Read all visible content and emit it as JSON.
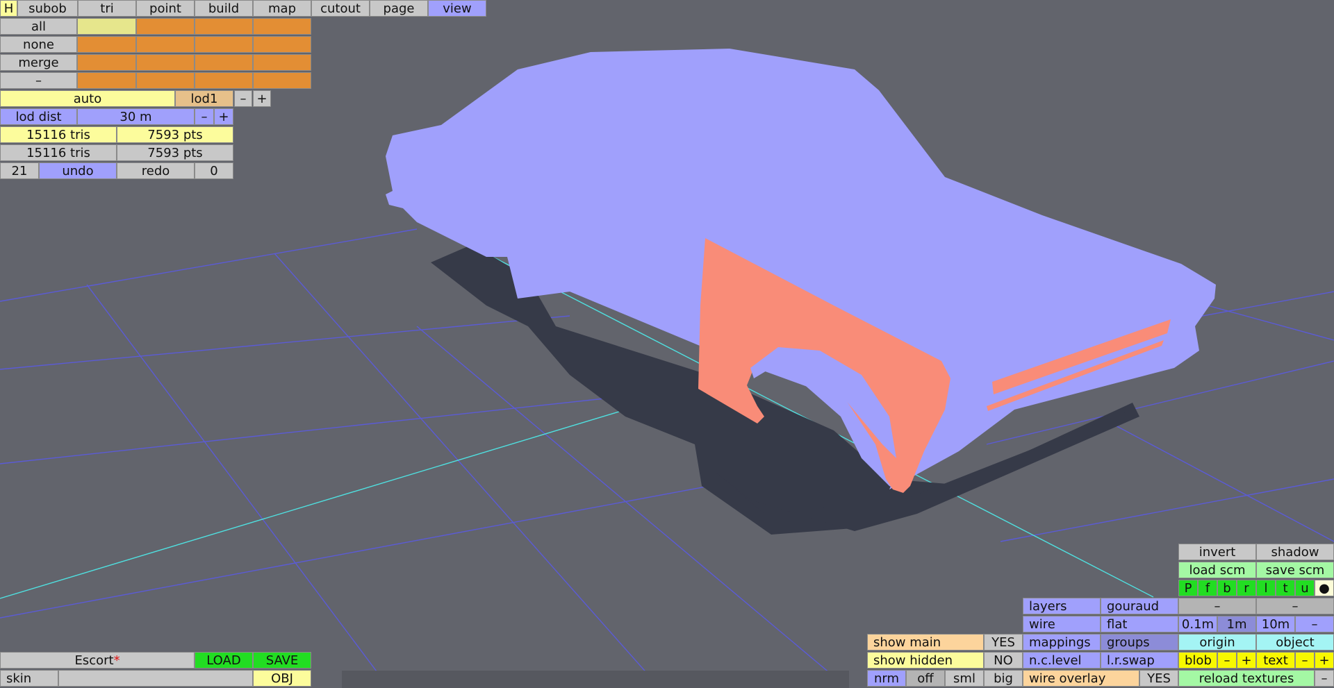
{
  "menubar": {
    "items": [
      {
        "label": "H",
        "color": "yellow"
      },
      {
        "label": "subob",
        "color": "gray"
      },
      {
        "label": "tri",
        "color": "gray"
      },
      {
        "label": "point",
        "color": "gray"
      },
      {
        "label": "build",
        "color": "gray"
      },
      {
        "label": "map",
        "color": "gray"
      },
      {
        "label": "cutout",
        "color": "gray"
      },
      {
        "label": "page",
        "color": "gray"
      },
      {
        "label": "view",
        "color": "blue"
      }
    ]
  },
  "selection": {
    "rows": [
      "all",
      "none",
      "merge",
      "–"
    ]
  },
  "lod": {
    "auto_label": "auto",
    "lod_label": "lod1",
    "minus": "–",
    "plus": "+",
    "dist_label": "lod dist",
    "dist_value": "30 m",
    "dist_minus": "–",
    "dist_plus": "+"
  },
  "stats": {
    "row1": {
      "tris": "15116 tris",
      "pts": "7593 pts"
    },
    "row2": {
      "tris": "15116 tris",
      "pts": "7593 pts"
    },
    "undo_count": "21",
    "undo_label": "undo",
    "redo_label": "redo",
    "redo_count": "0"
  },
  "file": {
    "name": "Escort",
    "modified_mark": "*",
    "load_label": "LOAD",
    "save_label": "SAVE",
    "skin_label": "skin",
    "skin_value": "",
    "obj_label": "OBJ"
  },
  "display": {
    "show_main_label": "show main",
    "show_main_value": "YES",
    "show_hidden_label": "show hidden",
    "show_hidden_value": "NO",
    "nrm_label": "nrm",
    "nrm_opts": [
      "off",
      "sml",
      "big"
    ],
    "wire_overlay_label": "wire overlay",
    "wire_overlay_value": "YES"
  },
  "render": {
    "layers": "layers",
    "gouraud": "gouraud",
    "wire": "wire",
    "flat": "flat",
    "mappings": "mappings",
    "groups": "groups",
    "nclevel": "n.c.level",
    "lrswap": "l.r.swap"
  },
  "camera": {
    "invert": "invert",
    "shadow": "shadow",
    "load_scm": "load scm",
    "save_scm": "save scm",
    "views": [
      "P",
      "f",
      "b",
      "r",
      "l",
      "t",
      "u",
      "●"
    ],
    "dash1": "–",
    "dash2": "–",
    "grid": [
      "0.1m",
      "1m",
      "10m",
      "–"
    ],
    "origin": "origin",
    "object": "object",
    "blob": "blob",
    "blob_minus": "–",
    "blob_plus": "+",
    "text": "text",
    "text_minus": "–",
    "text_plus": "+",
    "reload": "reload textures",
    "reload_minus": "–"
  },
  "status_bar": {
    "text": ""
  },
  "colors": {
    "background": "#62646c",
    "car_body": "#a0a0fc",
    "car_selected": "#f98c78",
    "shadow": "#363a48",
    "grid_blue": "#5b5bd6",
    "grid_cyan": "#4fe0e0"
  }
}
